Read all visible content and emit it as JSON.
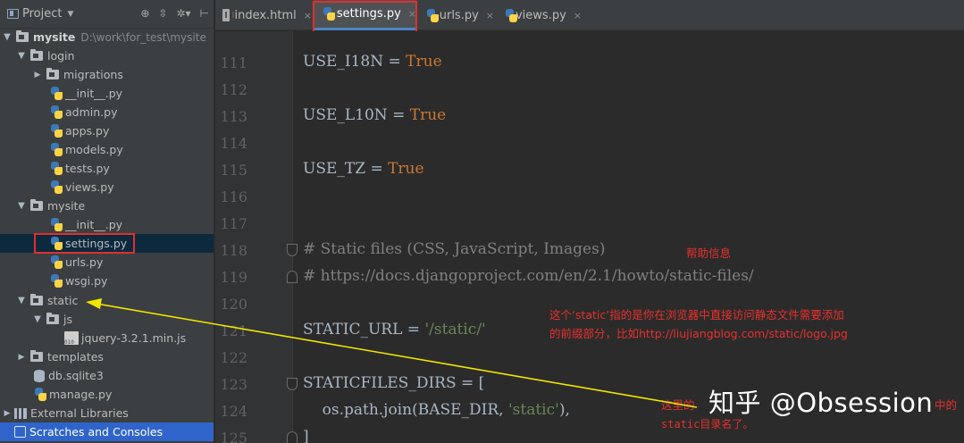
{
  "project_panel": {
    "title": "Project",
    "tree": [
      {
        "label": "mysite",
        "path": "D:\\work\\for_test\\mysite"
      },
      {
        "label": "login"
      },
      {
        "label": "migrations"
      },
      {
        "label": "__init__.py"
      },
      {
        "label": "admin.py"
      },
      {
        "label": "apps.py"
      },
      {
        "label": "models.py"
      },
      {
        "label": "tests.py"
      },
      {
        "label": "views.py"
      },
      {
        "label": "mysite"
      },
      {
        "label": "__init__.py"
      },
      {
        "label": "settings.py"
      },
      {
        "label": "urls.py"
      },
      {
        "label": "wsgi.py"
      },
      {
        "label": "static"
      },
      {
        "label": "js"
      },
      {
        "label": "jquery-3.2.1.min.js"
      },
      {
        "label": "templates"
      },
      {
        "label": "db.sqlite3"
      },
      {
        "label": "manage.py"
      },
      {
        "label": "External Libraries"
      },
      {
        "label": "Scratches and Consoles"
      }
    ]
  },
  "tabs": [
    {
      "label": "index.html",
      "icon": "html-file-icon"
    },
    {
      "label": "settings.py",
      "icon": "python-file-icon",
      "active": true
    },
    {
      "label": "urls.py",
      "icon": "python-file-icon"
    },
    {
      "label": "views.py",
      "icon": "python-file-icon"
    }
  ],
  "editor": {
    "lines": [
      {
        "no": "111",
        "parts": [
          {
            "t": "USE_I18N = ",
            "c": ""
          },
          {
            "t": "True",
            "c": "kw"
          }
        ]
      },
      {
        "no": "112",
        "parts": []
      },
      {
        "no": "113",
        "parts": [
          {
            "t": "USE_L10N = ",
            "c": ""
          },
          {
            "t": "True",
            "c": "kw"
          }
        ]
      },
      {
        "no": "114",
        "parts": []
      },
      {
        "no": "115",
        "parts": [
          {
            "t": "USE_TZ = ",
            "c": ""
          },
          {
            "t": "True",
            "c": "kw"
          }
        ]
      },
      {
        "no": "116",
        "parts": []
      },
      {
        "no": "117",
        "parts": []
      },
      {
        "no": "118",
        "parts": [
          {
            "t": "# Static files (CSS, JavaScript, Images)",
            "c": "cm"
          }
        ]
      },
      {
        "no": "119",
        "parts": [
          {
            "t": "# https://docs.djangoproject.com/en/2.1/howto/static-files/",
            "c": "cm"
          }
        ]
      },
      {
        "no": "120",
        "parts": []
      },
      {
        "no": "121",
        "parts": [
          {
            "t": "STATIC_URL = ",
            "c": ""
          },
          {
            "t": "'/static/'",
            "c": "str"
          }
        ]
      },
      {
        "no": "122",
        "parts": []
      },
      {
        "no": "123",
        "parts": [
          {
            "t": "STATICFILES_DIRS = [",
            "c": ""
          }
        ]
      },
      {
        "no": "124",
        "parts": [
          {
            "t": "    os.path.join(BASE_DIR, ",
            "c": ""
          },
          {
            "t": "'static'",
            "c": "str"
          },
          {
            "t": "),",
            "c": ""
          }
        ]
      },
      {
        "no": "125",
        "parts": [
          {
            "t": "]",
            "c": ""
          }
        ]
      }
    ]
  },
  "annotations": {
    "help_info": "帮助信息",
    "static_note_1": "这个‘static’指的是你在浏览器中直接访问静态文件需要添加",
    "static_note_2": "的前缀部分，比如http://liujiangblog.com/static/logo.jpg",
    "dirs_note_1a": "这里的",
    "dirs_note_1b": "中的",
    "dirs_note_2": "static目录名了。"
  },
  "watermark": "知乎 @Obsession",
  "colors": {
    "annotation_red": "#e8302c",
    "arrow_yellow": "#f2e600",
    "highlight_box_red": "#e0302e"
  }
}
